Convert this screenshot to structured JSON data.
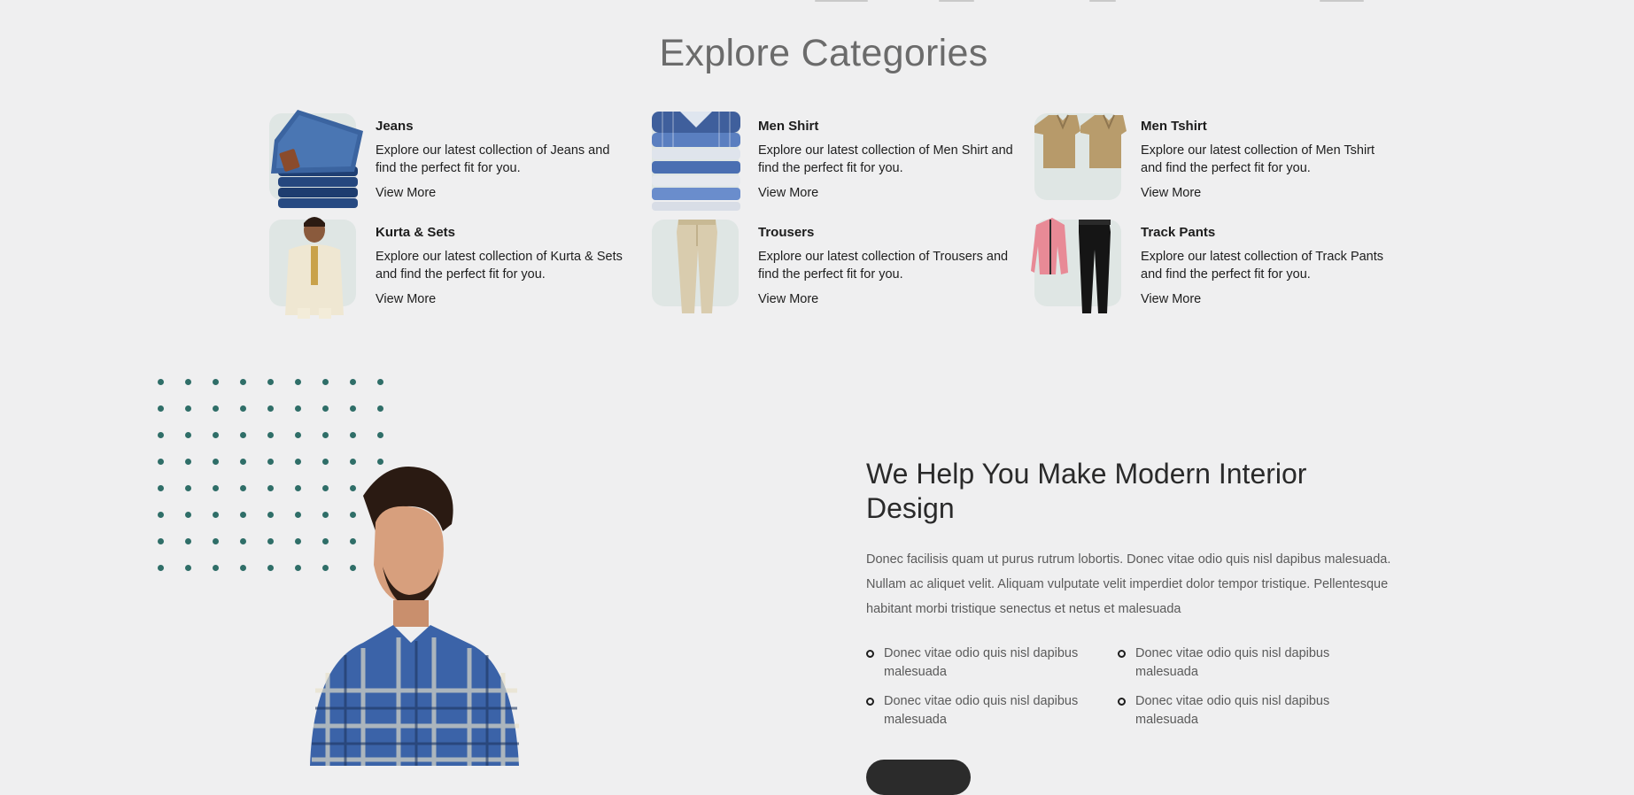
{
  "categories_section": {
    "title": "Explore Categories",
    "items": [
      {
        "name": "Jeans",
        "desc": "Explore our latest collection of Jeans and find the perfect fit for you.",
        "link": "View More",
        "icon": "jeans-image"
      },
      {
        "name": "Men Shirt",
        "desc": "Explore our latest collection of Men Shirt and find the perfect fit for you.",
        "link": "View More",
        "icon": "shirt-image"
      },
      {
        "name": "Men Tshirt",
        "desc": "Explore our latest collection of Men Tshirt and find the perfect fit for you.",
        "link": "View More",
        "icon": "tshirt-image"
      },
      {
        "name": "Kurta & Sets",
        "desc": "Explore our latest collection of Kurta & Sets and find the perfect fit for you.",
        "link": "View More",
        "icon": "kurta-image"
      },
      {
        "name": "Trousers",
        "desc": "Explore our latest collection of Trousers and find the perfect fit for you.",
        "link": "View More",
        "icon": "trousers-image"
      },
      {
        "name": "Track Pants",
        "desc": "Explore our latest collection of Track Pants and find the perfect fit for you.",
        "link": "View More",
        "icon": "trackpants-image"
      }
    ]
  },
  "help_section": {
    "title": "We Help You Make Modern Interior Design",
    "text": "Donec facilisis quam ut purus rutrum lobortis. Donec vitae odio quis nisl dapibus malesuada. Nullam ac aliquet velit. Aliquam vulputate velit imperdiet dolor tempor tristique. Pellentesque habitant morbi tristique senectus et netus et malesuada",
    "bullets": [
      "Donec vitae odio quis nisl dapibus malesuada",
      "Donec vitae odio quis nisl dapibus malesuada",
      "Donec vitae odio quis nisl dapibus malesuada",
      "Donec vitae odio quis nisl dapibus malesuada"
    ]
  },
  "colors": {
    "background": "#efeff0",
    "accent_teal": "#2f6e68",
    "thumb_bg": "#dfe6e4",
    "button_dark": "#2b2b2b"
  }
}
